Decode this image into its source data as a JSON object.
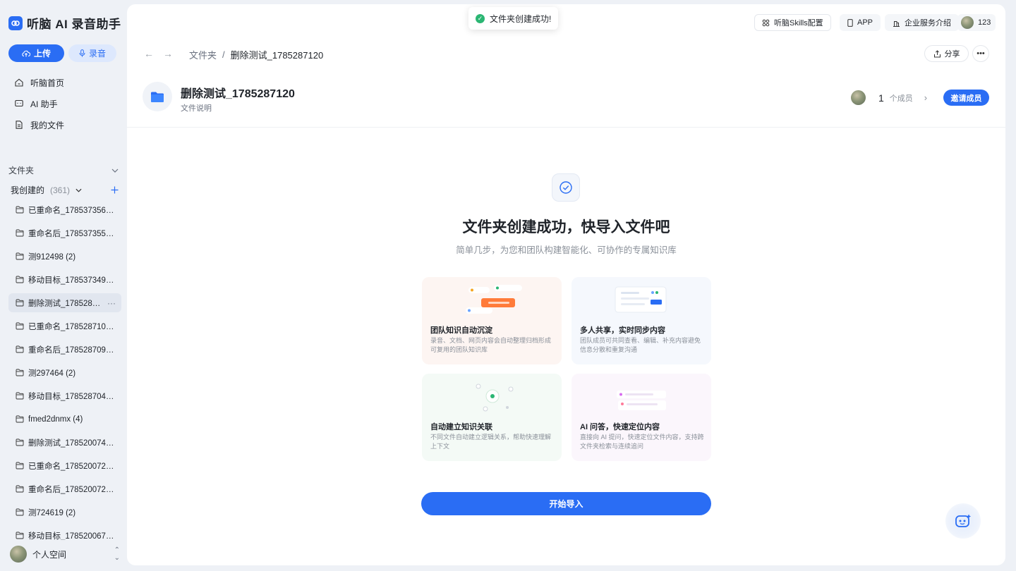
{
  "app": {
    "title": "听脑 AI 录音助手"
  },
  "sidebar": {
    "upload_label": "上传",
    "record_label": "录音",
    "nav": [
      {
        "label": "听脑首页",
        "icon": "home-icon"
      },
      {
        "label": "AI 助手",
        "icon": "chat-icon"
      },
      {
        "label": "我的文件",
        "icon": "file-icon"
      }
    ],
    "folders_section": "文件夹",
    "mine_label": "我创建的",
    "mine_count": "(361)",
    "folders": [
      "已重命名_1785373562 ...",
      "重命名后_1785373552 ...",
      "测912498 (2)",
      "移动目标_1785373497 ...",
      "删除测试_17852871...",
      "已重命名_1785287107 (...",
      "重命名后_1785287096 ...",
      "测297464 (2)",
      "移动目标_1785287046 ...",
      "fmed2dnmx (4)",
      "删除测试_1785200743 ...",
      "已重命名_1785200729 ...",
      "重命名后_1785200720 ...",
      "测724619 (2)",
      "移动目标_1785200673 ..."
    ],
    "active_folder_index": 4,
    "space_label": "个人空间"
  },
  "topbar": {
    "toast": "文件夹创建成功!",
    "skills_label": "听脑Skills配置",
    "app_label": "APP",
    "enterprise_label": "企业服务介绍",
    "user_label": "123"
  },
  "breadcrumb": {
    "root": "文件夹",
    "sep": "/",
    "current": "删除测试_1785287120"
  },
  "share_label": "分享",
  "folder": {
    "title": "删除测试_1785287120",
    "desc": "文件说明",
    "member_count": "1",
    "member_unit": "个成员",
    "invite_label": "邀请成员"
  },
  "hero": {
    "title": "文件夹创建成功，快导入文件吧",
    "subtitle": "简单几步，为您和团队构建智能化、可协作的专属知识库"
  },
  "cards": [
    {
      "title": "团队知识自动沉淀",
      "desc": "录音、文档、网页内容会自动整理归档形成可复用的团队知识库"
    },
    {
      "title": "多人共享，实时同步内容",
      "desc": "团队成员可共同查看、编辑、补充内容避免信息分散和重复沟通"
    },
    {
      "title": "自动建立知识关联",
      "desc": "不同文件自动建立逻辑关系，帮助快速理解上下文"
    },
    {
      "title": "AI 问答，快速定位内容",
      "desc": "直接向 AI 提问，快速定位文件内容，支持跨文件夹检索与连续追问"
    }
  ],
  "start_label": "开始导入",
  "colors": {
    "accent": "#2a6df4",
    "success": "#2bb673"
  }
}
